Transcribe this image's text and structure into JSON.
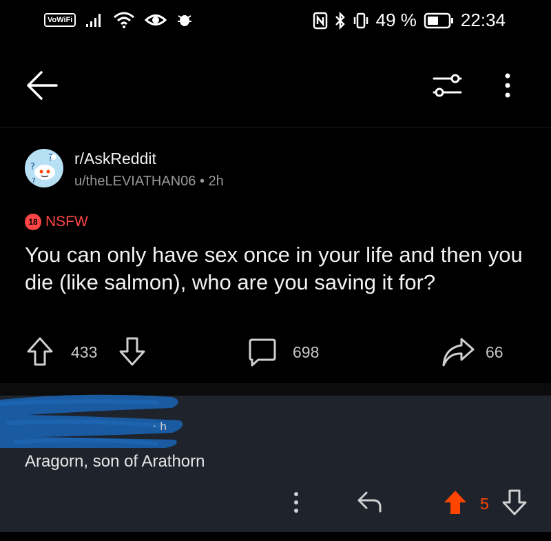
{
  "status_bar": {
    "vowifi": "VoWiFi",
    "battery": "49 %",
    "time": "22:34"
  },
  "post": {
    "subreddit": "r/AskReddit",
    "author": "u/theLEVIATHAN06",
    "age": "2h",
    "nsfw_badge": "18",
    "nsfw_label": "NSFW",
    "title": "You can only have sex once in your life and then you die (like salmon), who are you saving it for?",
    "upvotes": "433",
    "comments": "698",
    "shares": "66"
  },
  "comment": {
    "body": "Aragorn, son of Arathorn",
    "votes": "5"
  },
  "colors": {
    "accent_orange": "#ff4500",
    "nsfw_red": "#ff4545",
    "comment_bg": "#1e232c"
  }
}
